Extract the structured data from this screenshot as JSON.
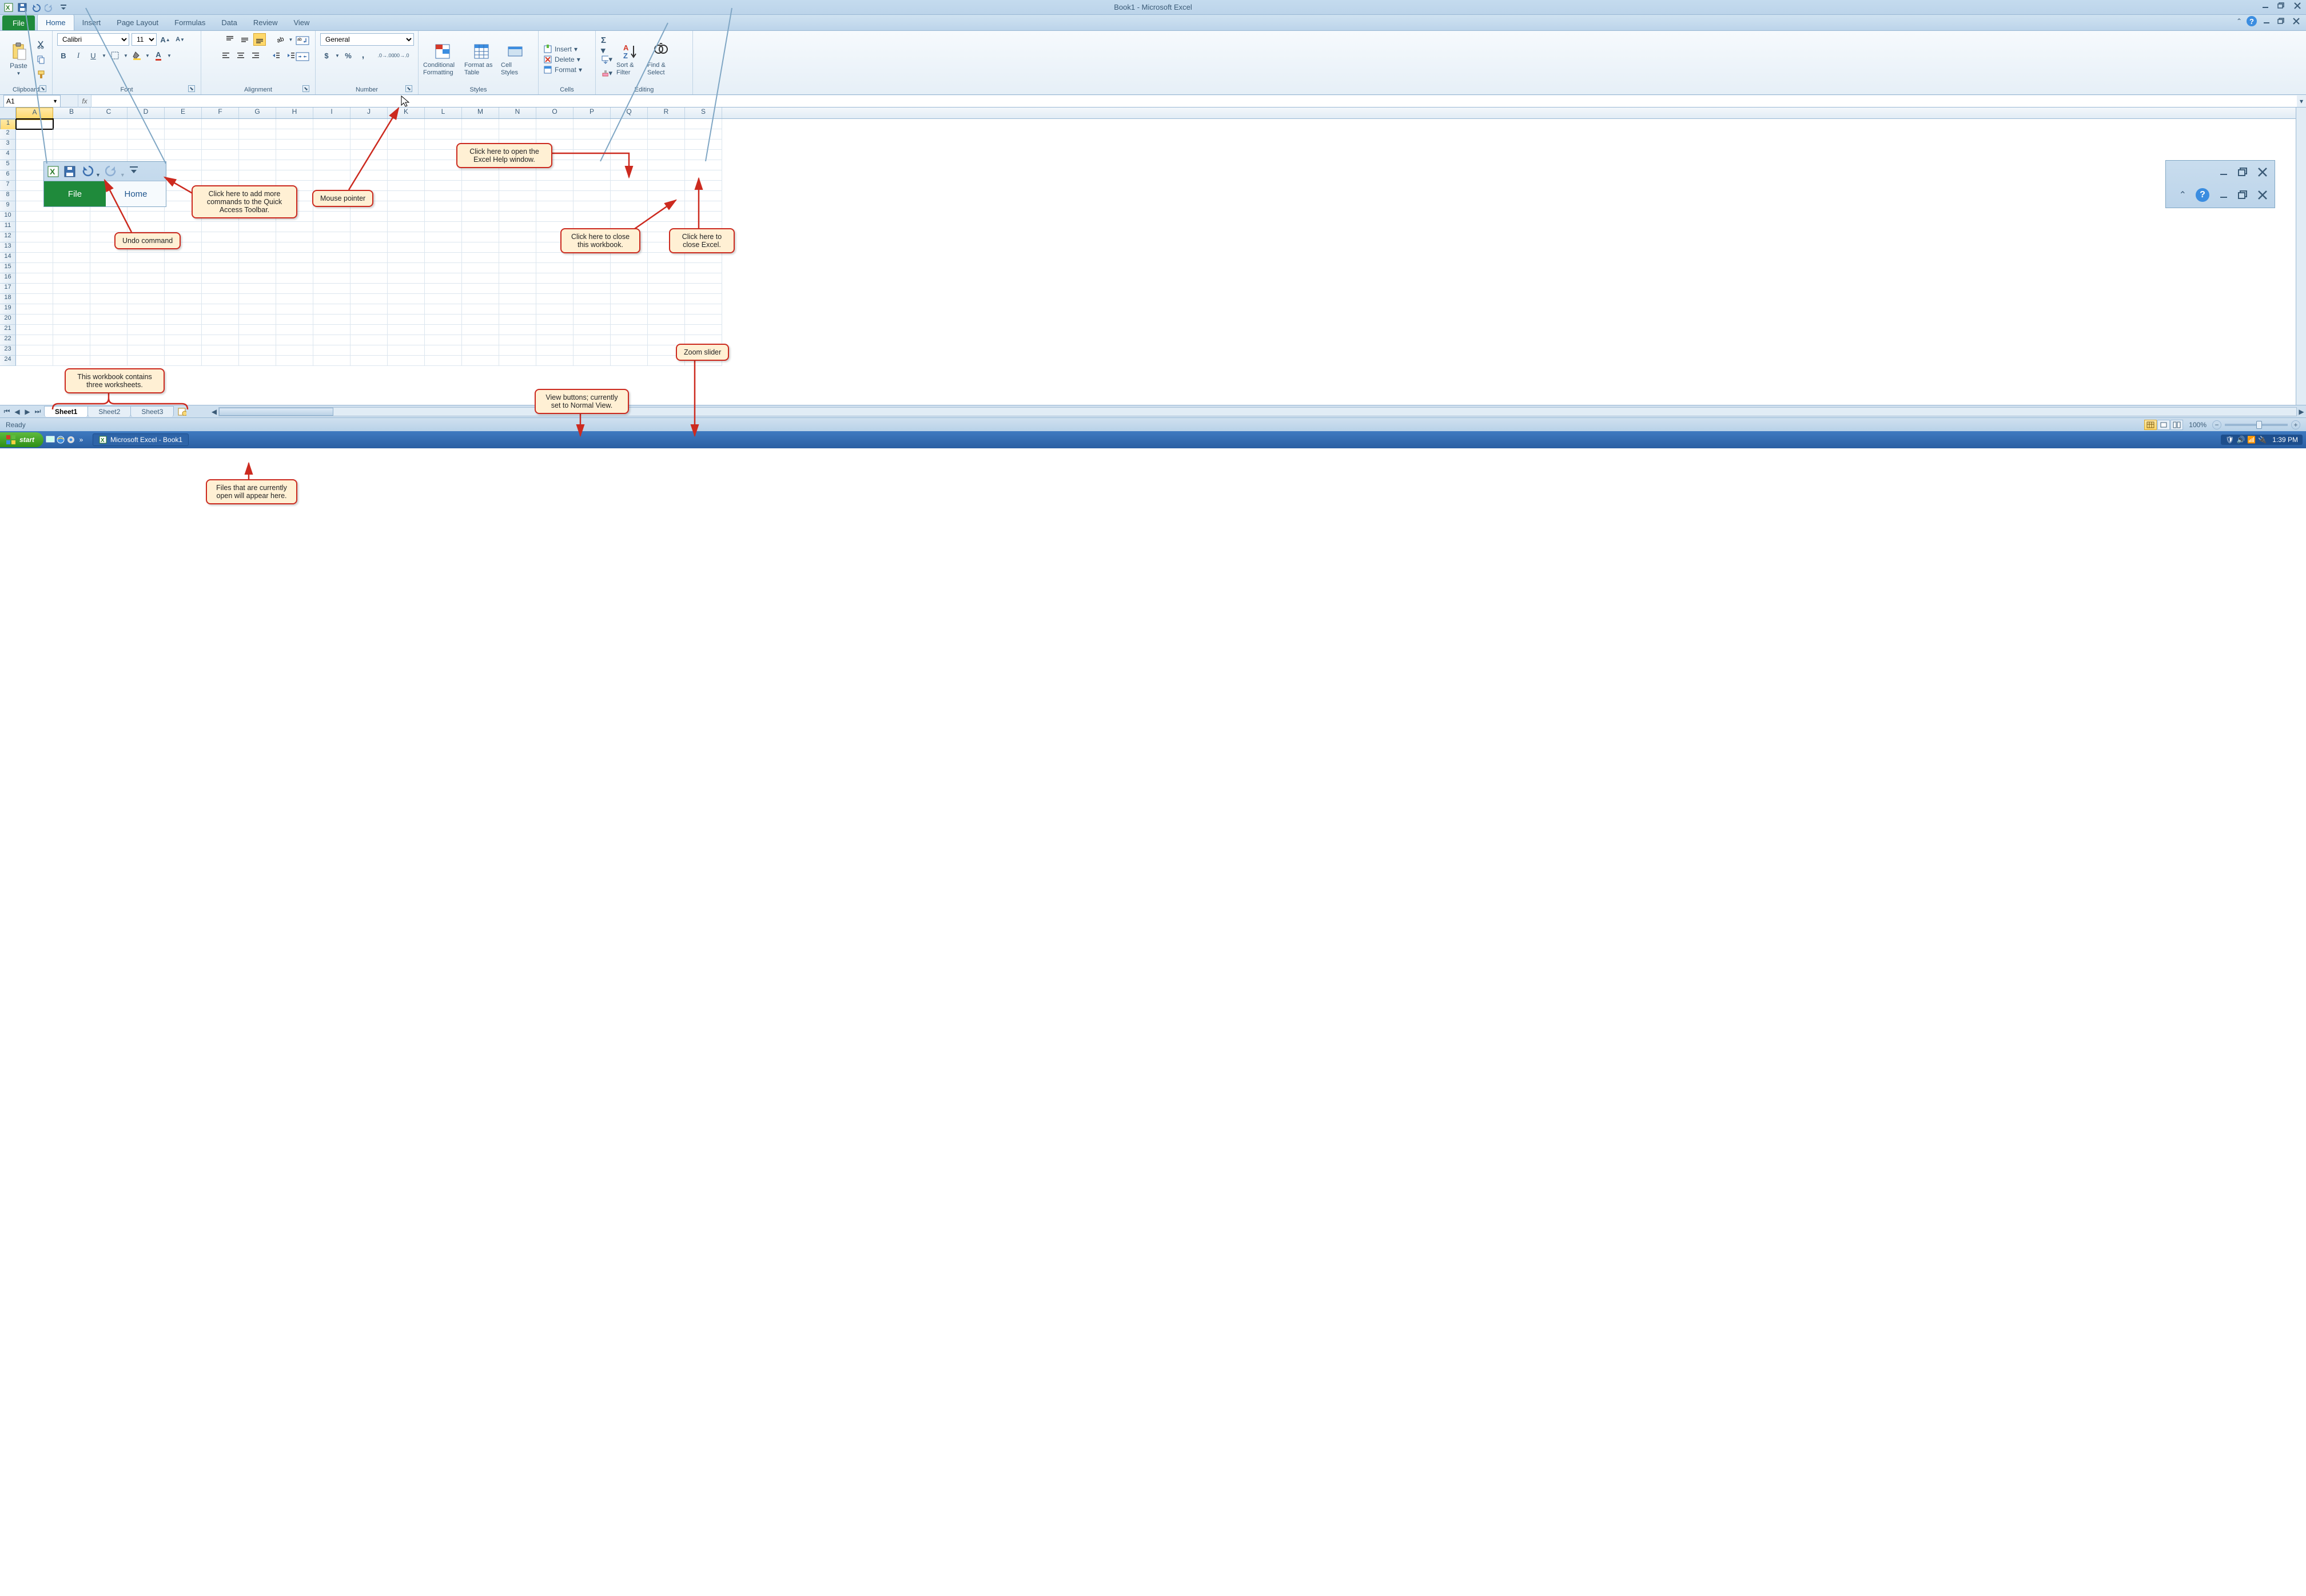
{
  "title": "Book1 - Microsoft Excel",
  "tabs": {
    "file": "File",
    "home": "Home",
    "insert": "Insert",
    "pageLayout": "Page Layout",
    "formulas": "Formulas",
    "data": "Data",
    "review": "Review",
    "view": "View"
  },
  "ribbon": {
    "clipboard": {
      "paste": "Paste",
      "label": "Clipboard"
    },
    "font": {
      "family": "Calibri",
      "size": "11",
      "label": "Font"
    },
    "alignment": {
      "label": "Alignment"
    },
    "number": {
      "format": "General",
      "label": "Number"
    },
    "styles": {
      "cond": "Conditional Formatting",
      "fat": "Format as Table",
      "cell": "Cell Styles",
      "label": "Styles"
    },
    "cells": {
      "insert": "Insert",
      "delete": "Delete",
      "format": "Format",
      "label": "Cells"
    },
    "editing": {
      "sort": "Sort & Filter",
      "find": "Find & Select",
      "label": "Editing"
    }
  },
  "namebox": "A1",
  "columns": [
    "A",
    "B",
    "C",
    "D",
    "E",
    "F",
    "G",
    "H",
    "I",
    "J",
    "K",
    "L",
    "M",
    "N",
    "O",
    "P",
    "Q",
    "R",
    "S"
  ],
  "rows": [
    1,
    2,
    3,
    4,
    5,
    6,
    7,
    8,
    9,
    10,
    11,
    12,
    13,
    14,
    15,
    16,
    17,
    18,
    19,
    20,
    21,
    22,
    23,
    24
  ],
  "sheets": {
    "s1": "Sheet1",
    "s2": "Sheet2",
    "s3": "Sheet3"
  },
  "status": {
    "ready": "Ready",
    "zoom": "100%"
  },
  "taskbar": {
    "start": "start",
    "app": "Microsoft Excel - Book1",
    "time": "1:39 PM"
  },
  "zoomqat": {
    "file": "File",
    "home": "Home"
  },
  "callouts": {
    "qat": "Click here to add more commands to the Quick Access Toolbar.",
    "undo": "Undo command",
    "mouse": "Mouse pointer",
    "help": "Click here to open the Excel Help window.",
    "closewb": "Click here to close this workbook.",
    "closeex": "Click here to close Excel.",
    "zoom": "Zoom slider",
    "views": "View buttons; currently set to Normal View.",
    "sheets": "This workbook contains three worksheets.",
    "files": "Files that are currently open will appear here."
  }
}
